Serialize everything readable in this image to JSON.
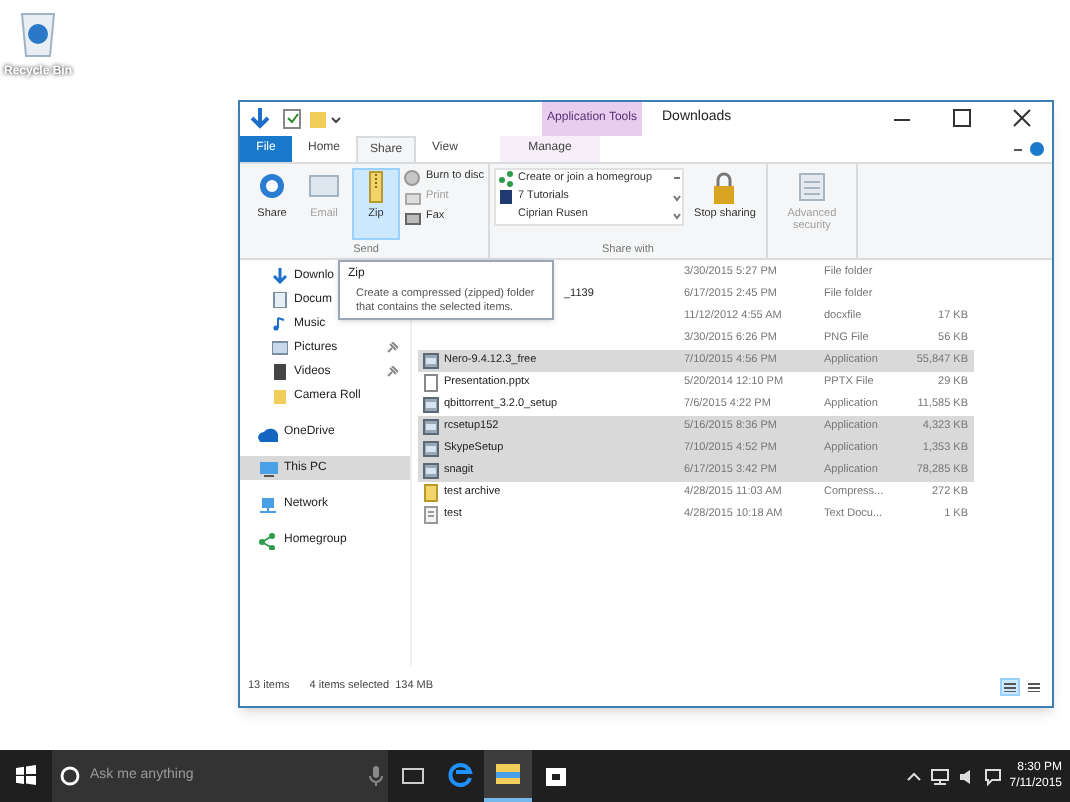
{
  "desktop": {
    "icons": [
      {
        "label": "Recycle Bin"
      }
    ]
  },
  "window": {
    "title": "Downloads",
    "context_group": "Application Tools"
  },
  "ribbon_tabs": [
    {
      "label": "File",
      "kind": "file",
      "selected": false
    },
    {
      "label": "Home",
      "kind": "tab",
      "selected": false
    },
    {
      "label": "Share",
      "kind": "tab",
      "selected": true
    },
    {
      "label": "View",
      "kind": "tab",
      "selected": false
    },
    {
      "label": "Manage",
      "kind": "context",
      "selected": false
    }
  ],
  "ribbon_groups": [
    {
      "label": "Send",
      "commands": [
        {
          "label": "Share",
          "kind": "large",
          "disabled": false,
          "hovered": false
        },
        {
          "label": "Email",
          "kind": "large",
          "disabled": true,
          "hovered": false
        },
        {
          "label": "Zip",
          "kind": "large",
          "disabled": false,
          "hovered": true
        },
        {
          "label": "Burn to disc",
          "kind": "small",
          "disabled": false
        },
        {
          "label": "Print",
          "kind": "small",
          "disabled": true
        },
        {
          "label": "Fax",
          "kind": "small",
          "disabled": false
        }
      ]
    },
    {
      "label": "Share with",
      "commands": [
        {
          "kind": "gallery",
          "items": [
            "Create or join a homegroup",
            "7 Tutorials",
            "Ciprian Rusen"
          ]
        },
        {
          "label": "Stop sharing",
          "kind": "large",
          "disabled": false,
          "hovered": false
        }
      ]
    },
    {
      "commands": [
        {
          "label": "Advanced security",
          "kind": "large",
          "disabled": true,
          "hovered": false
        }
      ]
    }
  ],
  "tooltip": {
    "title": "Zip",
    "text": "Create a compressed (zipped) folder that contains the selected items."
  },
  "nav_pane": {
    "quick_access_items": [
      {
        "label": "Downlo",
        "pinned": false
      },
      {
        "label": "Docum",
        "pinned": false
      },
      {
        "label": "Music",
        "pinned": false
      },
      {
        "label": "Pictures",
        "pinned": true
      },
      {
        "label": "Videos",
        "pinned": true
      },
      {
        "label": "Camera Roll",
        "pinned": false
      }
    ],
    "items": [
      {
        "label": "OneDrive",
        "selected": false
      },
      {
        "label": "This PC",
        "selected": true
      },
      {
        "label": "Network",
        "selected": false
      },
      {
        "label": "Homegroup",
        "selected": false
      }
    ]
  },
  "files": [
    {
      "kind": "hidden",
      "date": "3/30/2015 5:27 PM",
      "type": "File folder",
      "selected": false
    },
    {
      "kind": "hidden",
      "name": "_1139",
      "date": "6/17/2015 2:45 PM",
      "type": "File folder",
      "selected": false
    },
    {
      "kind": "hidden",
      "date": "11/12/2012 4:55 AM",
      "type": "docxfile",
      "size": "17 KB",
      "selected": false
    },
    {
      "kind": "hidden",
      "date": "3/30/2015 6:26 PM",
      "type": "PNG File",
      "size": "56 KB",
      "selected": false
    },
    {
      "kind": "app",
      "name": "Nero-9.4.12.3_free",
      "date": "7/10/2015 4:56 PM",
      "type": "Application",
      "size": "55,847 KB",
      "selected": true
    },
    {
      "kind": "pptx",
      "name": "Presentation.pptx",
      "date": "5/20/2014 12:10 PM",
      "type": "PPTX File",
      "size": "29 KB",
      "selected": false
    },
    {
      "kind": "app",
      "name": "qbittorrent_3.2.0_setup",
      "date": "7/6/2015 4:22 PM",
      "type": "Application",
      "size": "11,585 KB",
      "selected": false
    },
    {
      "kind": "app",
      "name": "rcsetup152",
      "date": "5/16/2015 8:36 PM",
      "type": "Application",
      "size": "4,323 KB",
      "selected": true
    },
    {
      "kind": "app",
      "name": "SkypeSetup",
      "date": "7/10/2015 4:52 PM",
      "type": "Application",
      "size": "1,353 KB",
      "selected": true
    },
    {
      "kind": "app",
      "name": "snagit",
      "date": "6/17/2015 3:42 PM",
      "type": "Application",
      "size": "78,285 KB",
      "selected": true
    },
    {
      "kind": "archive",
      "name": "test archive",
      "date": "4/28/2015 11:03 AM",
      "type": "Compress...",
      "size": "272 KB",
      "selected": false
    },
    {
      "kind": "text",
      "name": "test",
      "date": "4/28/2015 10:18 AM",
      "type": "Text Docu...",
      "size": "1 KB",
      "selected": false
    }
  ],
  "status_bar": {
    "item_count": "13 items",
    "selection": "4 items selected  134 MB",
    "view_buttons": [
      {
        "selected": true
      },
      {
        "selected": false
      }
    ]
  },
  "taskbar": {
    "search_placeholder": "Ask me anything",
    "apps": [
      {
        "selected": false
      },
      {
        "selected": false
      },
      {
        "selected": true
      },
      {
        "selected": false
      }
    ],
    "time": "8:30 PM",
    "date": "7/11/2015"
  }
}
